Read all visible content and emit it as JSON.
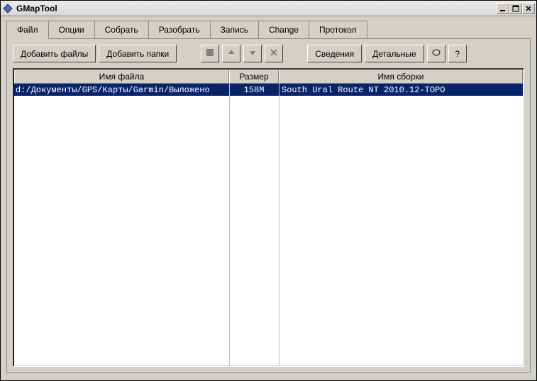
{
  "window": {
    "title": "GMapTool"
  },
  "tabs": [
    {
      "label": "Файл",
      "active": true
    },
    {
      "label": "Опции"
    },
    {
      "label": "Собрать"
    },
    {
      "label": "Разобрать"
    },
    {
      "label": "Запись"
    },
    {
      "label": "Change"
    },
    {
      "label": "Протокол"
    }
  ],
  "toolbar": {
    "add_files": "Добавить файлы",
    "add_folders": "Добавить папки",
    "info": "Сведения",
    "details": "Детальные",
    "circle": "O",
    "help": "?"
  },
  "table": {
    "headers": {
      "filename": "Имя файла",
      "size": "Размер",
      "mapname": "Имя сборки"
    },
    "rows": [
      {
        "filename": "d:/Документы/GPS/Карты/Garmin/Выложено",
        "size": "158M",
        "mapname": "South Ural Route NT 2010.12-TOPO",
        "selected": true
      }
    ]
  }
}
